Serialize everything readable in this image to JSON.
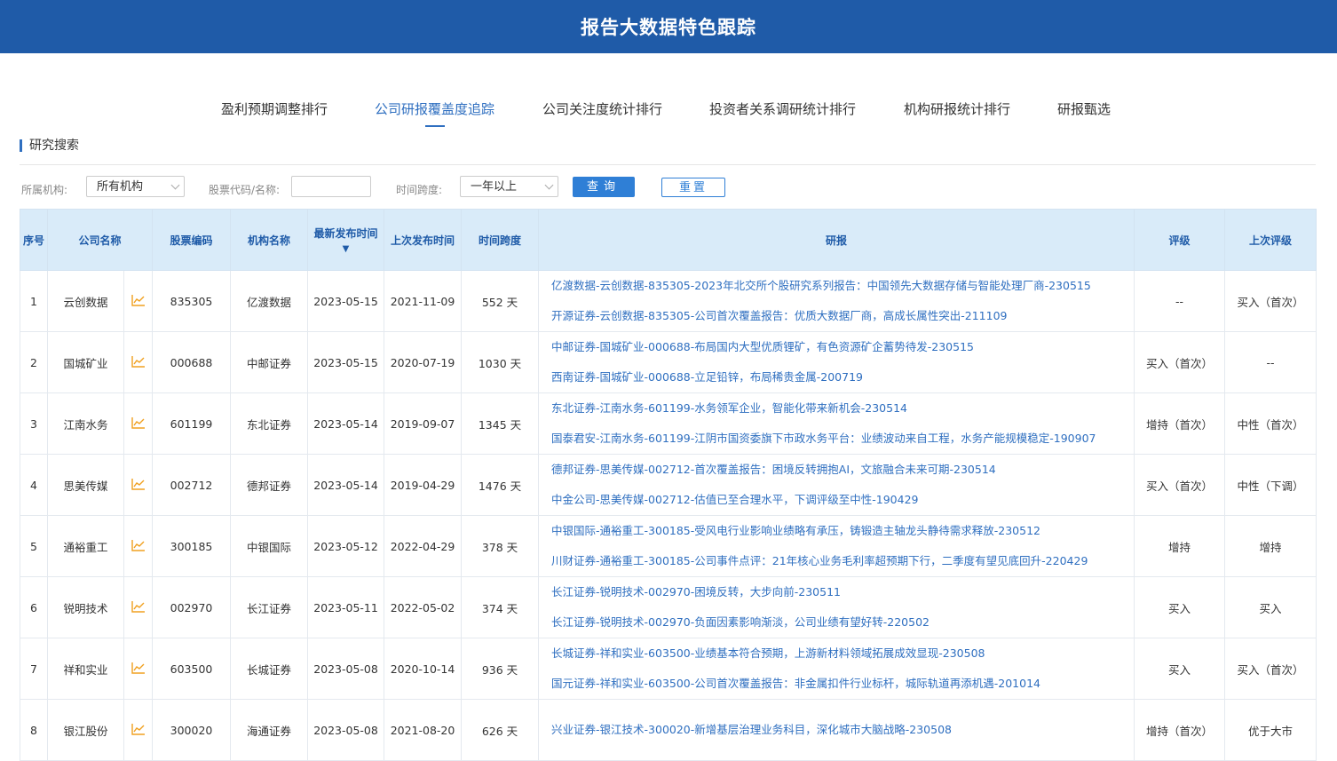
{
  "header": {
    "title": "报告大数据特色跟踪"
  },
  "tabs": [
    {
      "label": "盈利预期调整排行",
      "active": false
    },
    {
      "label": "公司研报覆盖度追踪",
      "active": true
    },
    {
      "label": "公司关注度统计排行",
      "active": false
    },
    {
      "label": "投资者关系调研统计排行",
      "active": false
    },
    {
      "label": "机构研报统计排行",
      "active": false
    },
    {
      "label": "研报甄选",
      "active": false
    }
  ],
  "section": {
    "title": "研究搜索"
  },
  "filters": {
    "org_label": "所属机构:",
    "org_value": "所有机构",
    "code_label": "股票代码/名称:",
    "code_value": "",
    "span_label": "时间跨度:",
    "span_value": "一年以上",
    "query_label": "查询",
    "reset_label": "重置"
  },
  "table": {
    "headers": {
      "index": "序号",
      "company": "公司名称",
      "code": "股票编码",
      "org": "机构名称",
      "latest": "最新发布时间",
      "latest_sort": "▼",
      "prev": "上次发布时间",
      "span": "时间跨度",
      "reports": "研报",
      "rating": "评级",
      "prev_rating": "上次评级"
    },
    "rows": [
      {
        "index": "1",
        "company": "云创数据",
        "code": "835305",
        "org": "亿渡数据",
        "latest": "2023-05-15",
        "prev": "2021-11-09",
        "span": "552 天",
        "reports": [
          "亿渡数据-云创数据-835305-2023年北交所个股研究系列报告：中国领先大数据存储与智能处理厂商-230515",
          "开源证券-云创数据-835305-公司首次覆盖报告：优质大数据厂商，高成长属性突出-211109"
        ],
        "rating": "--",
        "prev_rating": "买入（首次）"
      },
      {
        "index": "2",
        "company": "国城矿业",
        "code": "000688",
        "org": "中邮证券",
        "latest": "2023-05-15",
        "prev": "2020-07-19",
        "span": "1030 天",
        "reports": [
          "中邮证券-国城矿业-000688-布局国内大型优质锂矿，有色资源矿企蓄势待发-230515",
          "西南证券-国城矿业-000688-立足铅锌，布局稀贵金属-200719"
        ],
        "rating": "买入（首次）",
        "prev_rating": "--"
      },
      {
        "index": "3",
        "company": "江南水务",
        "code": "601199",
        "org": "东北证券",
        "latest": "2023-05-14",
        "prev": "2019-09-07",
        "span": "1345 天",
        "reports": [
          "东北证券-江南水务-601199-水务领军企业，智能化带来新机会-230514",
          "国泰君安-江南水务-601199-江阴市国资委旗下市政水务平台：业绩波动来自工程，水务产能规模稳定-190907"
        ],
        "rating": "增持（首次）",
        "prev_rating": "中性（首次）"
      },
      {
        "index": "4",
        "company": "思美传媒",
        "code": "002712",
        "org": "德邦证券",
        "latest": "2023-05-14",
        "prev": "2019-04-29",
        "span": "1476 天",
        "reports": [
          "德邦证券-思美传媒-002712-首次覆盖报告：困境反转拥抱AI，文旅融合未来可期-230514",
          "中金公司-思美传媒-002712-估值已至合理水平，下调评级至中性-190429"
        ],
        "rating": "买入（首次）",
        "prev_rating": "中性（下调）"
      },
      {
        "index": "5",
        "company": "通裕重工",
        "code": "300185",
        "org": "中银国际",
        "latest": "2023-05-12",
        "prev": "2022-04-29",
        "span": "378 天",
        "reports": [
          "中银国际-通裕重工-300185-受风电行业影响业绩略有承压，铸锻造主轴龙头静待需求释放-230512",
          "川财证券-通裕重工-300185-公司事件点评：21年核心业务毛利率超预期下行，二季度有望见底回升-220429"
        ],
        "rating": "增持",
        "prev_rating": "增持"
      },
      {
        "index": "6",
        "company": "锐明技术",
        "code": "002970",
        "org": "长江证券",
        "latest": "2023-05-11",
        "prev": "2022-05-02",
        "span": "374 天",
        "reports": [
          "长江证券-锐明技术-002970-困境反转，大步向前-230511",
          "长江证券-锐明技术-002970-负面因素影响渐淡，公司业绩有望好转-220502"
        ],
        "rating": "买入",
        "prev_rating": "买入"
      },
      {
        "index": "7",
        "company": "祥和实业",
        "code": "603500",
        "org": "长城证券",
        "latest": "2023-05-08",
        "prev": "2020-10-14",
        "span": "936 天",
        "reports": [
          "长城证券-祥和实业-603500-业绩基本符合预期，上游新材料领域拓展成效显现-230508",
          "国元证券-祥和实业-603500-公司首次覆盖报告：非金属扣件行业标杆，城际轨道再添机遇-201014"
        ],
        "rating": "买入",
        "prev_rating": "买入（首次）"
      },
      {
        "index": "8",
        "company": "银江股份",
        "code": "300020",
        "org": "海通证券",
        "latest": "2023-05-08",
        "prev": "2021-08-20",
        "span": "626 天",
        "reports": [
          "兴业证券-银江技术-300020-新增基层治理业务科目，深化城市大脑战略-230508",
          ""
        ],
        "rating": "增持（首次）",
        "prev_rating": "优于大市"
      }
    ]
  },
  "colors": {
    "header_bg": "#1f5ba8",
    "accent": "#2f6fc0",
    "chart_icon": "#f0a020",
    "table_head_bg": "#d9ebf9"
  }
}
